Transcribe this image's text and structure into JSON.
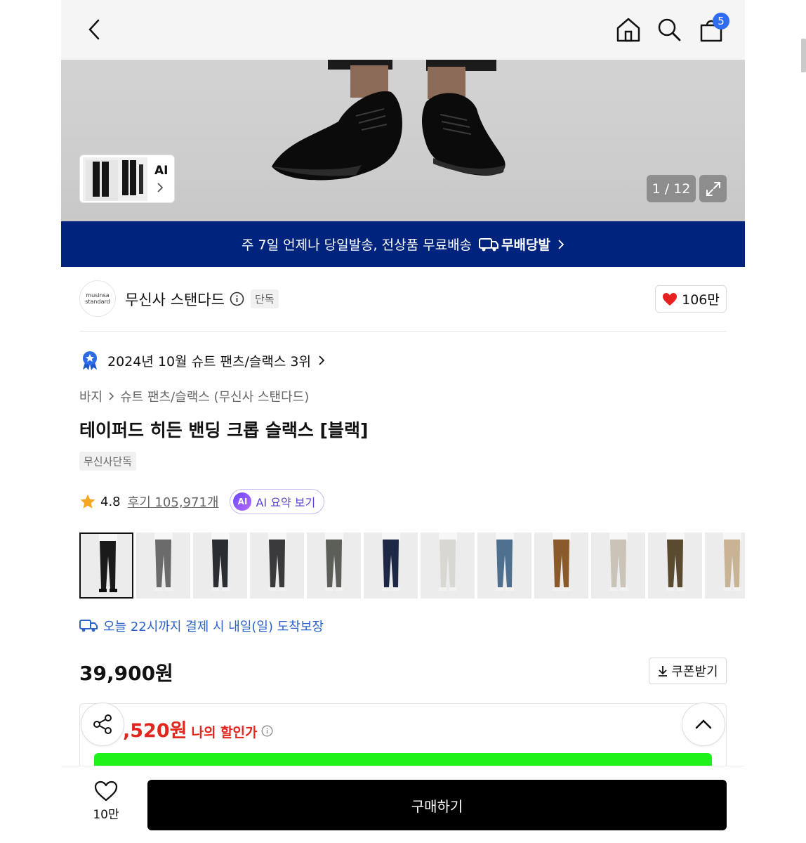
{
  "header": {
    "cart_count": "5"
  },
  "hero": {
    "ai_thumb_label": "AI",
    "counter": "1 / 12"
  },
  "banner": {
    "text": "주 7일 언제나 당일발송, 전상품 무료배송",
    "logo_text": "무배당발"
  },
  "brand": {
    "logo_line1": "musinsa",
    "logo_line2": "standard",
    "name": "무신사 스탠다드",
    "tag": "단독",
    "likes": "106만"
  },
  "ranking": {
    "text": "2024년 10월 슈트 팬츠/슬랙스 3위"
  },
  "breadcrumb": {
    "level1": "바지",
    "level2": "슈트 팬츠/슬랙스 (무신사 스탠다드)"
  },
  "product": {
    "title": "테이퍼드 히든 밴딩 크롭 슬랙스 [블랙]",
    "exclusive_tag": "무신사단독",
    "rating": "4.8",
    "reviews": "후기 105,971개",
    "ai_badge": "AI",
    "ai_summary": "AI 요약 보기",
    "colors": [
      "#1a1a1a",
      "#6b6b6b",
      "#2a2e33",
      "#3a3a3c",
      "#5c5f58",
      "#1d2847",
      "#d9d7d2",
      "#4f6f8f",
      "#8a5a2b",
      "#c9c3b8",
      "#5a4a2f",
      "#c8b394"
    ]
  },
  "delivery": {
    "text": "오늘 22시까지 결제 시 내일(일) 도착보장"
  },
  "pricing": {
    "price": "39,900원",
    "coupon_label": "쿠폰받기",
    "discount_amount": ",520원",
    "discount_label": "나의 할인가"
  },
  "bottom": {
    "wish_count": "10만",
    "buy_label": "구매하기"
  }
}
